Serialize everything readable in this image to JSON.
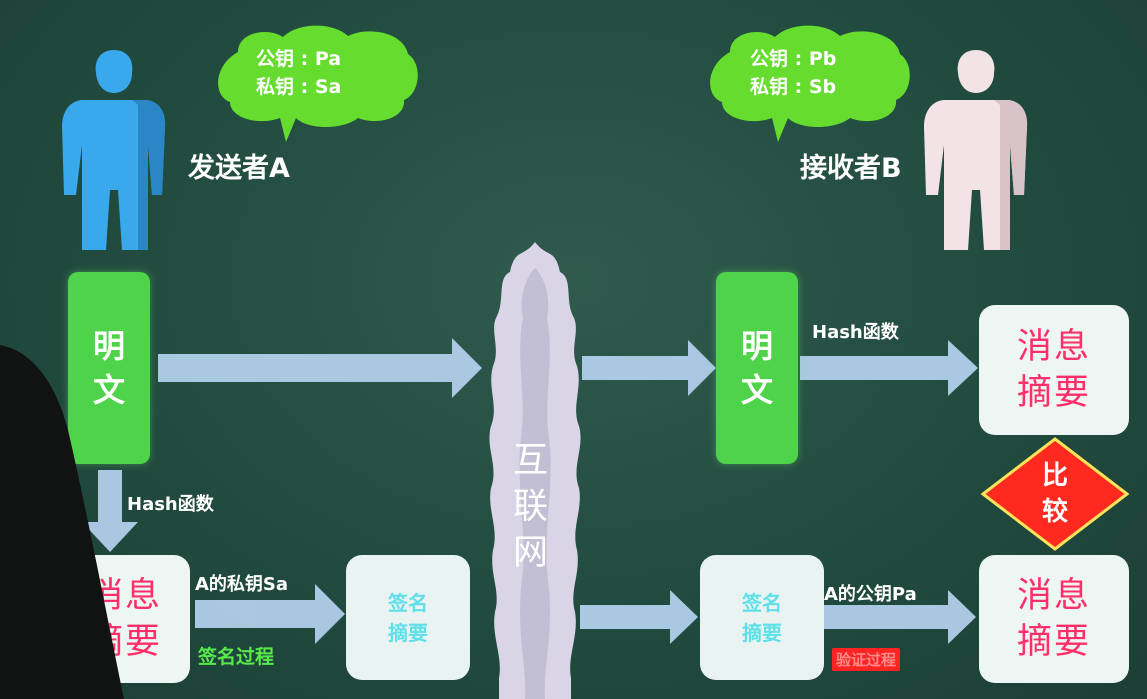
{
  "sender": {
    "label": "发送者A",
    "keys": {
      "public": "公钥 : Pa",
      "private": "私钥 : Sa"
    }
  },
  "receiver": {
    "label": "接收者B",
    "keys": {
      "public": "公钥 : Pb",
      "private": "私钥 : Sb"
    }
  },
  "plaintext": [
    "明",
    "文"
  ],
  "internet": [
    "互",
    "联",
    "网"
  ],
  "digest": [
    "消息",
    "摘要"
  ],
  "signed_digest": [
    "签名",
    "摘要"
  ],
  "compare": [
    "比",
    "较"
  ],
  "labels": {
    "hash_fn": "Hash函数",
    "sign_with_private": "A的私钥Sa",
    "sign_process": "签名过程",
    "verify_with_public": "A的公钥Pa",
    "verify_process": "验证过程"
  },
  "colors": {
    "board": "#214a3e",
    "bubble": "#66dd2e",
    "plaintext_box": "#4fd34a",
    "arrow": "#b5d3ef",
    "digest_text": "#ff2f6a",
    "compare_fill": "#ff2a1f",
    "compare_border": "#ffe35a",
    "sender_figure": "#3aa9ec",
    "receiver_figure": "#f1e3e6"
  }
}
